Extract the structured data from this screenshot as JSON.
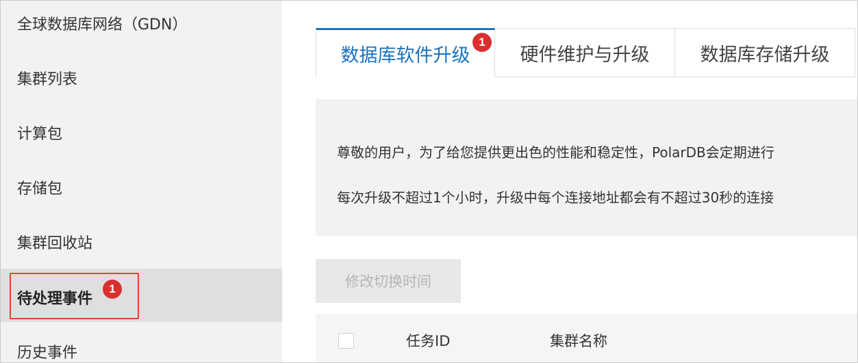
{
  "sidebar": {
    "items": [
      {
        "label": "全球数据库网络（GDN）"
      },
      {
        "label": "集群列表"
      },
      {
        "label": "计算包"
      },
      {
        "label": "存储包"
      },
      {
        "label": "集群回收站"
      },
      {
        "label": "待处理事件",
        "badge": "1",
        "active": true
      },
      {
        "label": "历史事件"
      }
    ]
  },
  "tabs": [
    {
      "label": "数据库软件升级",
      "badge": "1",
      "active": true
    },
    {
      "label": "硬件维护与升级"
    },
    {
      "label": "数据库存储升级"
    }
  ],
  "notice": {
    "line1": "尊敬的用户，为了给您提供更出色的性能和稳定性，PolarDB会定期进行",
    "line2": "每次升级不超过1个小时，升级中每个连接地址都会有不超过30秒的连接"
  },
  "toolbar": {
    "modify_switch_time": "修改切换时间"
  },
  "table": {
    "columns": [
      "任务ID",
      "集群名称"
    ]
  },
  "colors": {
    "accent": "#1a73bd",
    "badge": "#d9302f",
    "highlight": "#e0492d"
  }
}
